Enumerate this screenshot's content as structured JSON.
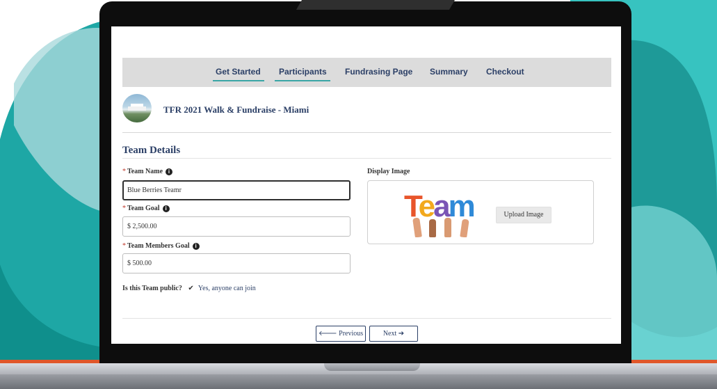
{
  "nav": {
    "tabs": [
      {
        "label": "Get Started",
        "active": true
      },
      {
        "label": "Participants",
        "active": true
      },
      {
        "label": "Fundrasing Page",
        "active": false
      },
      {
        "label": "Summary",
        "active": false
      },
      {
        "label": "Checkout",
        "active": false
      }
    ]
  },
  "event": {
    "title": "TFR 2021 Walk & Fundraise - Miami"
  },
  "section": {
    "title": "Team Details"
  },
  "form": {
    "required_mark": "*",
    "team_name": {
      "label": "Team Name",
      "value": "Blue Berries Teamr"
    },
    "team_goal": {
      "label": "Team Goal",
      "value": "$ 2,500.00"
    },
    "members_goal": {
      "label": "Team Members Goal",
      "value": "$ 500.00"
    },
    "info_icon": "info-circle-icon",
    "public": {
      "question": "Is this Team public?",
      "answer": "Yes, anyone can join",
      "check_glyph": "✔"
    }
  },
  "display_image": {
    "label": "Display Image",
    "image_text": "Team",
    "upload_label": "Upload Image"
  },
  "footer": {
    "previous_label": "Previous",
    "next_label": "Next",
    "prev_arrow": "🡐",
    "next_arrow": "➔"
  },
  "colors": {
    "nav_text": "#2b3f66",
    "tab_underline": "#3aa6a6",
    "teal_blob": "#3bbcb8",
    "orange_strip": "#e0572a",
    "laptop_bezel": "#0d0d0d"
  }
}
